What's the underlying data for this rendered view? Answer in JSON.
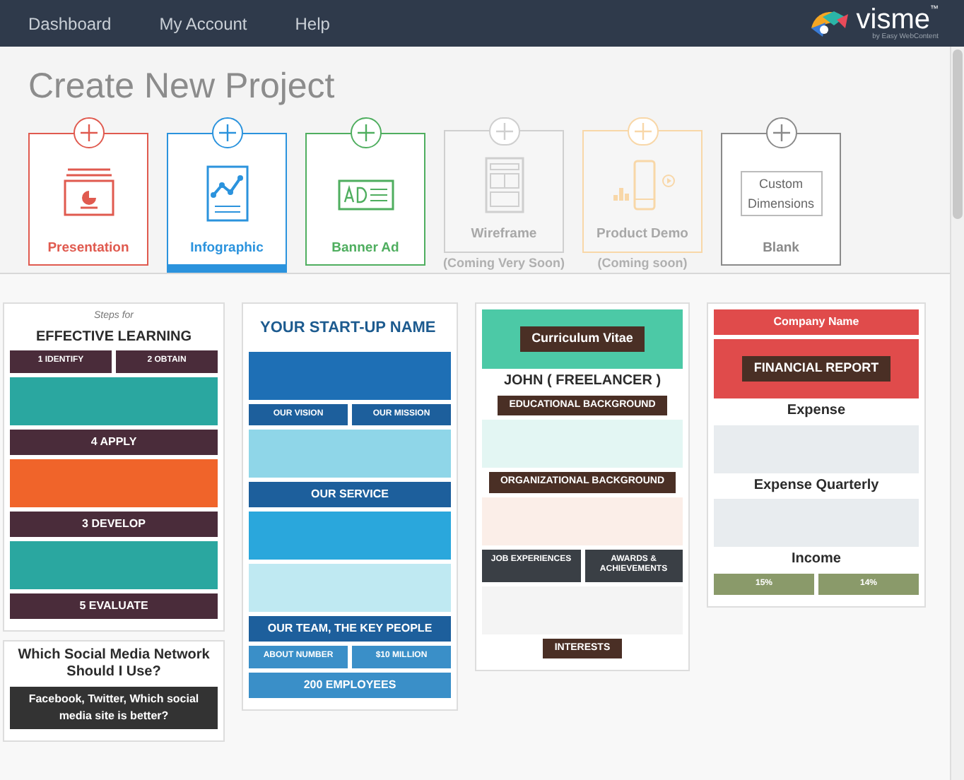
{
  "nav": {
    "links": [
      "Dashboard",
      "My Account",
      "Help"
    ],
    "logo": {
      "name": "visme",
      "mark": "™",
      "tagline": "by Easy WebContent"
    }
  },
  "heading": "Create New Project",
  "project_types": [
    {
      "kind": "presentation",
      "label": "Presentation",
      "color": "#e05a4f",
      "selected": false,
      "disabled": false
    },
    {
      "kind": "infographic",
      "label": "Infographic",
      "color": "#2b93dd",
      "selected": true,
      "disabled": false
    },
    {
      "kind": "banner",
      "label": "Banner Ad",
      "color": "#4fae5f",
      "selected": false,
      "disabled": false
    },
    {
      "kind": "wireframe",
      "label": "Wireframe",
      "note": "(Coming Very Soon)",
      "color": "#cfcfcf",
      "selected": false,
      "disabled": true
    },
    {
      "kind": "demo",
      "label": "Product Demo",
      "note": "(Coming soon)",
      "color": "#f8d7a8",
      "selected": false,
      "disabled": true
    },
    {
      "kind": "blank",
      "label": "Blank",
      "box_text": "Custom Dimensions",
      "color": "#8a8a8a",
      "selected": false,
      "disabled": false
    }
  ],
  "templates": [
    {
      "cards": [
        {
          "bands": [
            {
              "kind": "caption",
              "text": "Steps for"
            },
            {
              "kind": "title",
              "text": "EFFECTIVE LEARNING"
            },
            {
              "kind": "pair",
              "texts": [
                "1 IDENTIFY",
                "2 OBTAIN"
              ],
              "color": "#4a2c3a"
            },
            {
              "kind": "panel",
              "color": "#2aa7a0"
            },
            {
              "kind": "bar",
              "text": "4 APPLY",
              "color": "#4a2c3a"
            },
            {
              "kind": "panel",
              "color": "#f0642a"
            },
            {
              "kind": "bar",
              "text": "3 DEVELOP",
              "color": "#4a2c3a"
            },
            {
              "kind": "panel",
              "color": "#2aa7a0"
            },
            {
              "kind": "bar",
              "text": "5 EVALUATE",
              "color": "#4a2c3a"
            }
          ]
        },
        {
          "bands": [
            {
              "kind": "title",
              "text": "Which Social Media Network Should I Use?"
            },
            {
              "kind": "bar",
              "text": "Facebook, Twitter, Which social media site is better?",
              "color": "#333333"
            }
          ]
        }
      ]
    },
    {
      "cards": [
        {
          "bands": [
            {
              "kind": "box",
              "text": "YOUR START-UP NAME"
            },
            {
              "kind": "panel",
              "color": "#1e6fb5"
            },
            {
              "kind": "pair",
              "texts": [
                "OUR VISION",
                "OUR MISSION"
              ],
              "color": "#1d5f9c"
            },
            {
              "kind": "panel",
              "color": "#8fd6e8"
            },
            {
              "kind": "bar",
              "text": "OUR SERVICE",
              "color": "#1d5f9c"
            },
            {
              "kind": "panel",
              "color": "#2aa7dc"
            },
            {
              "kind": "panel",
              "color": "#bfe9f2"
            },
            {
              "kind": "bar",
              "text": "OUR TEAM, THE KEY PEOPLE",
              "color": "#1d5f9c"
            },
            {
              "kind": "pair",
              "texts": [
                "ABOUT NUMBER",
                "$10 MILLION"
              ],
              "color": "#3a8fc8"
            },
            {
              "kind": "bar",
              "text": "200 EMPLOYEES",
              "color": "#3a8fc8"
            }
          ]
        }
      ]
    },
    {
      "cards": [
        {
          "bands": [
            {
              "kind": "banner",
              "text": "Curriculum Vitae",
              "color": "#4cc9a6"
            },
            {
              "kind": "title",
              "text": "JOHN ( FREELANCER )"
            },
            {
              "kind": "chip",
              "text": "EDUCATIONAL BACKGROUND"
            },
            {
              "kind": "panel",
              "color": "#e3f6f3"
            },
            {
              "kind": "chip",
              "text": "ORGANIZATIONAL BACKGROUND"
            },
            {
              "kind": "panel",
              "color": "#fbeee8"
            },
            {
              "kind": "pair",
              "texts": [
                "JOB EXPERIENCES",
                "AWARDS & ACHIEVEMENTS"
              ],
              "color": "#3a3f45"
            },
            {
              "kind": "panel",
              "color": "#f4f4f4"
            },
            {
              "kind": "chip",
              "text": "INTERESTS"
            }
          ]
        }
      ]
    },
    {
      "cards": [
        {
          "bands": [
            {
              "kind": "bar",
              "text": "Company Name",
              "color": "#e04b4b"
            },
            {
              "kind": "banner",
              "text": "FINANCIAL REPORT",
              "color": "#e04b4b"
            },
            {
              "kind": "title",
              "text": "Expense"
            },
            {
              "kind": "panel",
              "color": "#e8ecef"
            },
            {
              "kind": "title",
              "text": "Expense Quarterly"
            },
            {
              "kind": "panel",
              "color": "#e8ecef"
            },
            {
              "kind": "title",
              "text": "Income"
            },
            {
              "kind": "pair",
              "texts": [
                "15%",
                "14%"
              ],
              "color": "#8a9a6a"
            }
          ]
        }
      ]
    }
  ]
}
